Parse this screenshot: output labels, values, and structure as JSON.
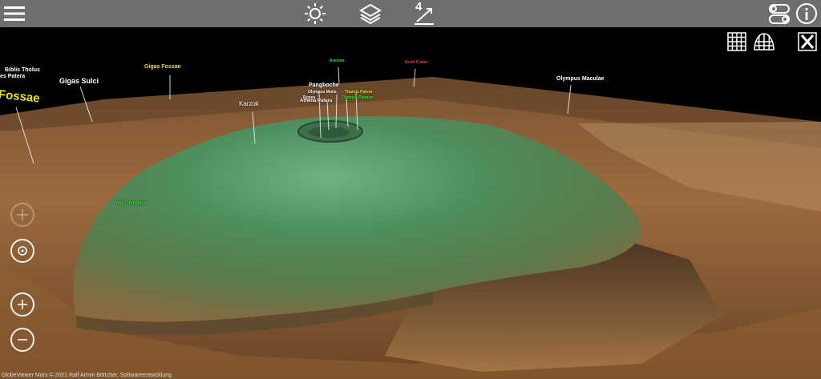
{
  "toolbar": {
    "menu_icon": "hamburger-menu-icon",
    "light_icon": "sun-icon",
    "layers_icon": "layers-icon",
    "measure_icon": "measure-icon",
    "measure_value": "4",
    "settings_icon": "toggle-switches-icon",
    "info_icon": "info-icon"
  },
  "overlay_buttons": {
    "grid_icon": "grid-icon",
    "globe_grid_icon": "globe-grid-icon",
    "close_icon": "close-x-icon"
  },
  "map_labels": {
    "fossae": "Fossae",
    "biblis_tholus": "Biblis Tholus",
    "ulysses_patera": "es Patera",
    "gigas_sulci": "Gigas Sulci",
    "gigas_fossae": "Gigas Fossae",
    "karzok": "Karzok",
    "pangboche": "Pangboche",
    "athena_patera": "Athena Patera",
    "olympus_maculae": "Olympus Maculae",
    "nix_olympica": "Nix Olympica",
    "green_top": "Arsinoe",
    "red_top": "Scott Crater",
    "small_labels": [
      "Olympus Mons",
      "Tharsis Patera",
      "Rupes",
      "Olympia Planum"
    ]
  },
  "nav_controls": {
    "pan": "pan-icon",
    "rotate": "rotate-icon",
    "zoom_in": "zoom-in-icon",
    "zoom_out": "zoom-out-icon"
  },
  "credit": "GlobeViewer Mars © 2021 Ralf Armin Böttcher, Softwareentwicklung",
  "colors": {
    "toolbar": "#6e6e6e",
    "sky": "#000000",
    "terrain_brown": "#8a5a35",
    "mons_green": "#4f8a5c",
    "label_yellow": "#e8e020",
    "label_white": "#ffffff",
    "label_green": "#30e830"
  }
}
